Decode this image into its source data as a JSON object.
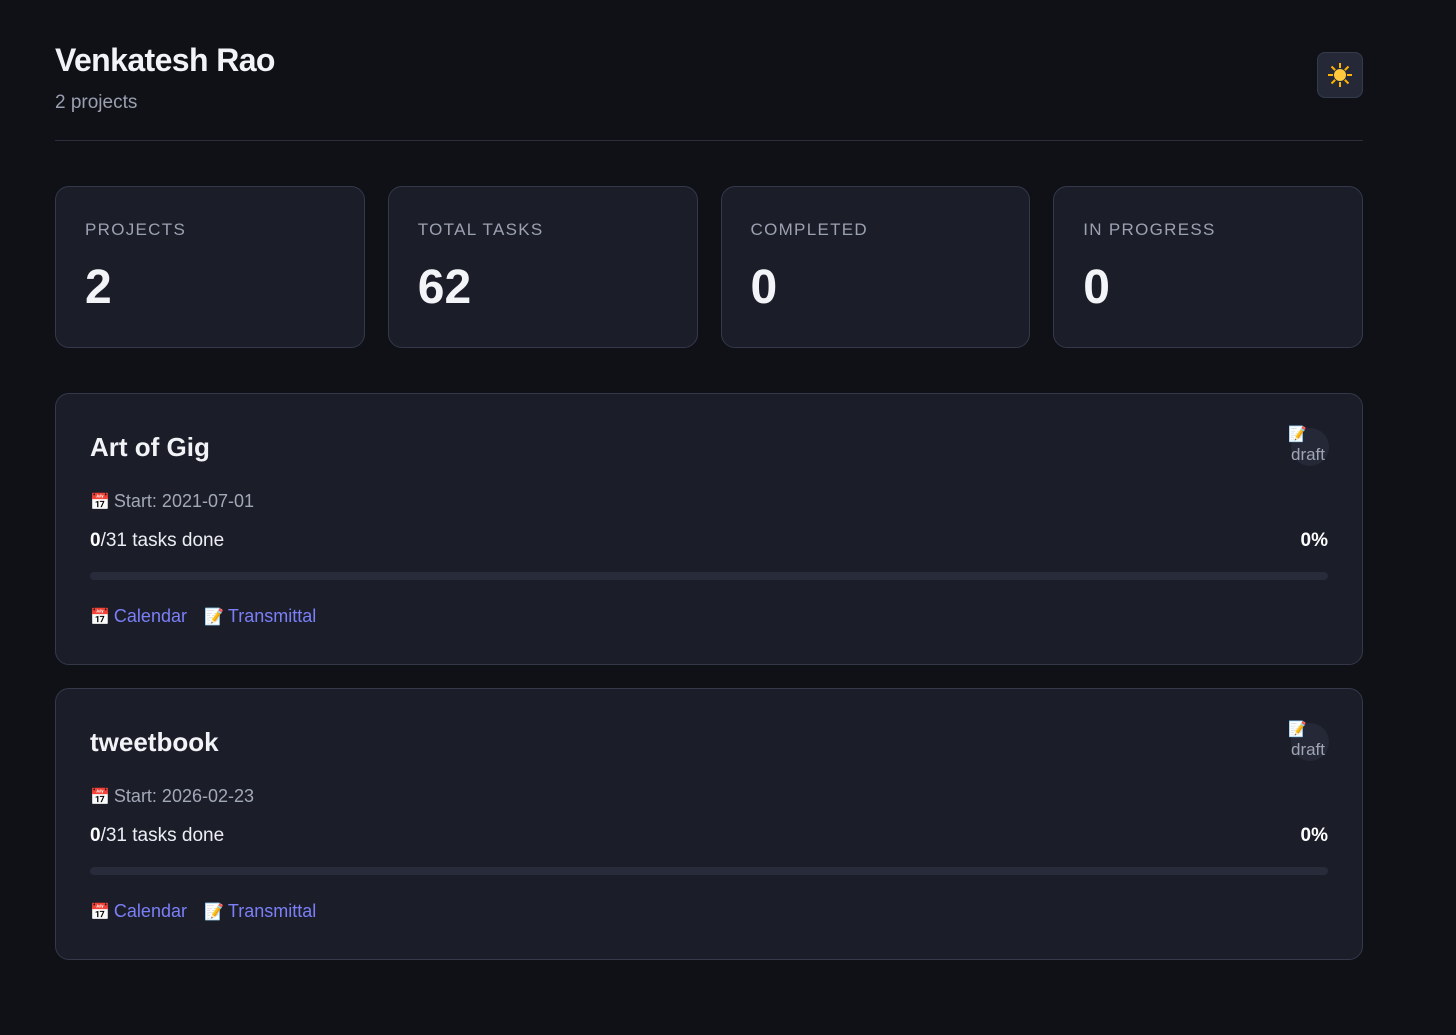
{
  "header": {
    "title": "Venkatesh Rao",
    "subtitle": "2 projects",
    "theme_toggle_icon": "sun-icon"
  },
  "stats": [
    {
      "label": "PROJECTS",
      "value": "2"
    },
    {
      "label": "TOTAL TASKS",
      "value": "62"
    },
    {
      "label": "COMPLETED",
      "value": "0"
    },
    {
      "label": "IN PROGRESS",
      "value": "0"
    }
  ],
  "projects": [
    {
      "name": "Art of Gig",
      "status_icon": "📝",
      "status": "draft",
      "start_icon": "📅",
      "start": "Start: 2021-07-01",
      "done": "0",
      "total_suffix": "/31 tasks done",
      "percent_label": "0%",
      "progress": 0,
      "links": [
        {
          "icon": "📅",
          "label": "Calendar"
        },
        {
          "icon": "📝",
          "label": "Transmittal"
        }
      ]
    },
    {
      "name": "tweetbook",
      "status_icon": "📝",
      "status": "draft",
      "start_icon": "📅",
      "start": "Start: 2026-02-23",
      "done": "0",
      "total_suffix": "/31 tasks done",
      "percent_label": "0%",
      "progress": 0,
      "links": [
        {
          "icon": "📅",
          "label": "Calendar"
        },
        {
          "icon": "📝",
          "label": "Transmittal"
        }
      ]
    }
  ],
  "colors": {
    "background": "#0f1117",
    "card": "#1b1e29",
    "accent": "#7b7ff8"
  }
}
